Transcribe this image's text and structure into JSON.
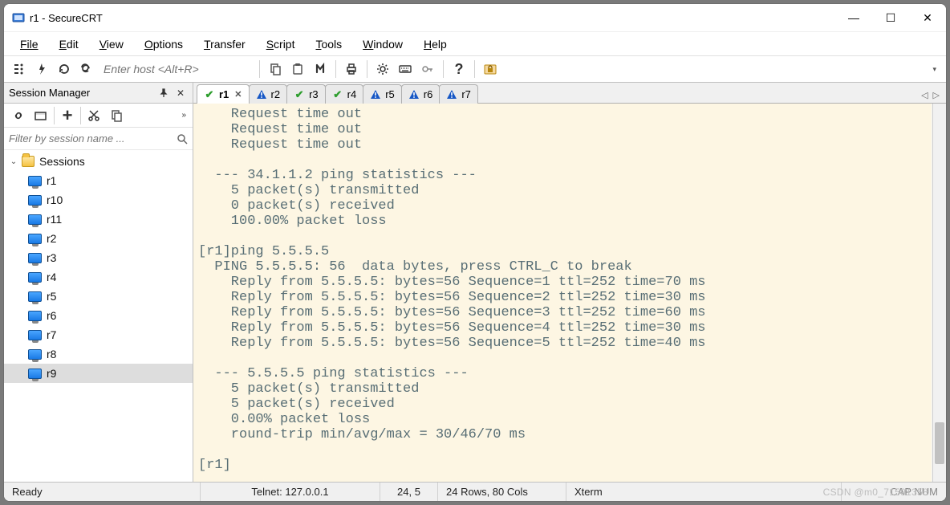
{
  "window": {
    "title": "r1 - SecureCRT",
    "minimize": "—",
    "maximize": "☐",
    "close": "✕"
  },
  "menu": {
    "file": "File",
    "edit": "Edit",
    "view": "View",
    "options": "Options",
    "transfer": "Transfer",
    "script": "Script",
    "tools": "Tools",
    "window": "Window",
    "help": "Help"
  },
  "toolbar": {
    "host_placeholder": "Enter host <Alt+R>"
  },
  "session_panel": {
    "title": "Session Manager",
    "pin": "📌",
    "close": "✕",
    "chevron": "»",
    "filter_placeholder": "Filter by session name ...",
    "root": "Sessions",
    "items": [
      "r1",
      "r10",
      "r11",
      "r2",
      "r3",
      "r4",
      "r5",
      "r6",
      "r7",
      "r8",
      "r9"
    ],
    "selected": "r9"
  },
  "tabs": {
    "list": [
      {
        "label": "r1",
        "status": "ok",
        "active": true,
        "close": true
      },
      {
        "label": "r2",
        "status": "warn"
      },
      {
        "label": "r3",
        "status": "ok"
      },
      {
        "label": "r4",
        "status": "ok"
      },
      {
        "label": "r5",
        "status": "warn"
      },
      {
        "label": "r6",
        "status": "warn"
      },
      {
        "label": "r7",
        "status": "warn"
      }
    ],
    "nav_left": "◁",
    "nav_right": "▷"
  },
  "terminal": {
    "text": "    Request time out\n    Request time out\n    Request time out\n\n  --- 34.1.1.2 ping statistics ---\n    5 packet(s) transmitted\n    0 packet(s) received\n    100.00% packet loss\n\n[r1]ping 5.5.5.5\n  PING 5.5.5.5: 56  data bytes, press CTRL_C to break\n    Reply from 5.5.5.5: bytes=56 Sequence=1 ttl=252 time=70 ms\n    Reply from 5.5.5.5: bytes=56 Sequence=2 ttl=252 time=30 ms\n    Reply from 5.5.5.5: bytes=56 Sequence=3 ttl=252 time=60 ms\n    Reply from 5.5.5.5: bytes=56 Sequence=4 ttl=252 time=30 ms\n    Reply from 5.5.5.5: bytes=56 Sequence=5 ttl=252 time=40 ms\n\n  --- 5.5.5.5 ping statistics ---\n    5 packet(s) transmitted\n    5 packet(s) received\n    0.00% packet loss\n    round-trip min/avg/max = 30/46/70 ms\n\n[r1]"
  },
  "status": {
    "ready": "Ready",
    "conn": "Telnet: 127.0.0.1",
    "pos": "24,   5",
    "size": "24 Rows, 80 Cols",
    "term": "Xterm",
    "caps": "CAP  NUM"
  },
  "watermark": "CSDN @m0_71591358"
}
